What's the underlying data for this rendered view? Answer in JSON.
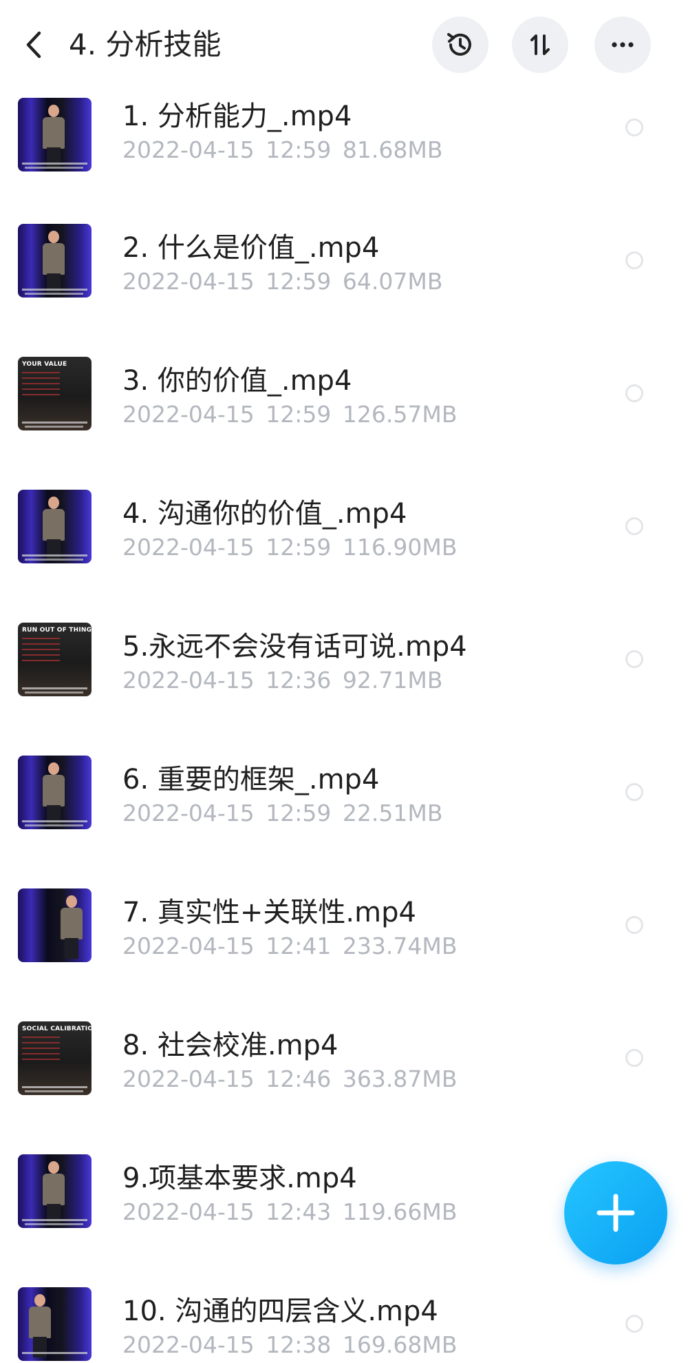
{
  "header": {
    "title": "4. 分析技能",
    "icons": {
      "back": "chevron-left-icon",
      "history": "history-icon",
      "sort": "sort-icon",
      "more": "more-icon"
    }
  },
  "files": [
    {
      "name": "1. 分析能力_.mp4",
      "date": "2022-04-15",
      "time": "12:59",
      "size": "81.68MB"
    },
    {
      "name": "2. 什么是价值_.mp4",
      "date": "2022-04-15",
      "time": "12:59",
      "size": "64.07MB"
    },
    {
      "name": "3. 你的价值_.mp4",
      "date": "2022-04-15",
      "time": "12:59",
      "size": "126.57MB",
      "thumb_text": "YOUR VALUE"
    },
    {
      "name": "4. 沟通你的价值_.mp4",
      "date": "2022-04-15",
      "time": "12:59",
      "size": "116.90MB"
    },
    {
      "name": "5.永远不会没有话可说.mp4",
      "date": "2022-04-15",
      "time": "12:36",
      "size": "92.71MB",
      "thumb_text": "RUN OUT OF THINGS TO SAY"
    },
    {
      "name": "6. 重要的框架_.mp4",
      "date": "2022-04-15",
      "time": "12:59",
      "size": "22.51MB"
    },
    {
      "name": "7. 真实性+关联性.mp4",
      "date": "2022-04-15",
      "time": "12:41",
      "size": "233.74MB"
    },
    {
      "name": "8. 社会校准.mp4",
      "date": "2022-04-15",
      "time": "12:46",
      "size": "363.87MB",
      "thumb_text": "SOCIAL CALIBRATION"
    },
    {
      "name": "9.项基本要求.mp4",
      "date": "2022-04-15",
      "time": "12:43",
      "size": "119.66MB"
    },
    {
      "name": "10. 沟通的四层含义.mp4",
      "date": "2022-04-15",
      "time": "12:38",
      "size": "169.68MB"
    }
  ],
  "fab": {
    "icon": "plus-icon"
  },
  "colors": {
    "fab": "#14b4f8",
    "meta_text": "#b3b7be",
    "title_text": "#222222"
  }
}
